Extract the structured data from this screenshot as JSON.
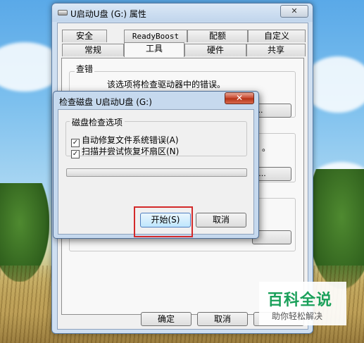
{
  "window": {
    "title": "U启动U盘 (G:) 属性",
    "close": "✕"
  },
  "tabs_row1": [
    "安全",
    "ReadyBoost",
    "配额",
    "自定义"
  ],
  "tabs_row2": [
    "常规",
    "工具",
    "硬件",
    "共享"
  ],
  "active_tab": "工具",
  "tools": {
    "check_group_label": "查错",
    "check_group_text": "该选项将检查驱动器中的错误。",
    "bg_btn1": "...",
    "bg_btn2": ")...",
    "bg_frag": "。"
  },
  "footer": {
    "ok": "确定",
    "cancel": "取消"
  },
  "dialog": {
    "title": "检查磁盘 U启动U盘 (G:)",
    "close": "✕",
    "options_label": "磁盘检查选项",
    "option1": "自动修复文件系统错误(A)",
    "option2": "扫描并尝试恢复坏扇区(N)",
    "option1_checked": true,
    "option2_checked": true,
    "start": "开始(S)",
    "cancel": "取消"
  },
  "watermark": {
    "title": "百科全说",
    "subtitle": "助你轻松解决"
  },
  "colors": {
    "highlight": "#d32a2a",
    "watermark_green": "#1aa05a"
  }
}
